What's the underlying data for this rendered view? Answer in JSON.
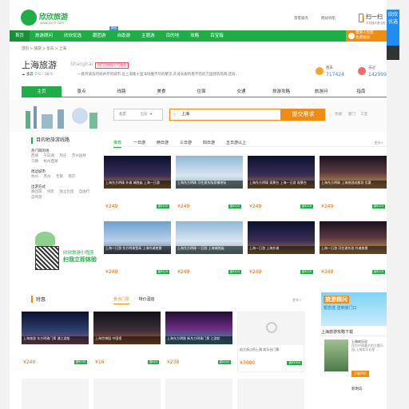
{
  "header": {
    "logo_text": "欣欣旅游",
    "logo_sub": "www.cncn.com",
    "links": [
      "游客服务",
      "网站导航",
      "扫一扫"
    ],
    "app_title": "扫一扫",
    "app_sub": "手机随手看全程"
  },
  "nav": {
    "items": [
      "首页",
      "旅游顾问",
      "欣欣优选",
      "跟团游",
      "自助游",
      "主题游",
      "目的地",
      "攻略",
      "百宝箱"
    ],
    "badge": "新品",
    "counsel_line1": "需要人帮您",
    "counsel_line2": "免费顾问"
  },
  "breadcrumb": "首页 > 旅游 > 华东 > 上海",
  "city": {
    "name": "上海旅游",
    "name_en": "Shanghai",
    "honor": "热门目的地人气旅游",
    "weather": "多云",
    "temp": "7℃ - 18℃",
    "intro": "一座开放与时尚并存的城市,位上海集十里洋场魔不尽的繁华,外滩长廊的看不完的万国建筑风情,还有..."
  },
  "stats": [
    {
      "label": "想去",
      "value": "717424"
    },
    {
      "label": "去过",
      "value": "142999"
    }
  ],
  "tabs": [
    "主页",
    "景点",
    "线路",
    "美食",
    "住宿",
    "交通",
    "旅游攻略",
    "旅游问",
    "指南"
  ],
  "search": {
    "city_label": "北京",
    "city_sub": "出发",
    "value": "上海",
    "button": "提交需求",
    "hot_label": "热搜:",
    "hot": [
      "厦门",
      "三亚"
    ]
  },
  "sidebar": {
    "title": "目的地旅游线路",
    "sections": [
      {
        "heading": "热门目的地",
        "links": [
          "西湖",
          "千岛湖",
          "周庄",
          "苏州园林",
          "乌镇",
          "杭州西湖"
        ]
      },
      {
        "heading": "周边城市",
        "links": [
          "杭州",
          "苏州",
          "无锡",
          "南京"
        ]
      },
      {
        "heading": "出游方式",
        "links": [
          "跟团游",
          "纯玩",
          "独立包团",
          "自由行",
          "自驾游"
        ]
      }
    ],
    "mini_line1": "欣欣旅游小程序",
    "mini_line2": "扫我立即体验"
  },
  "days_tabs": {
    "items": [
      "推荐",
      "一日游",
      "两日游",
      "三日游",
      "四日游",
      "五日游以上"
    ],
    "more": "更多>"
  },
  "route_cards": [
    {
      "title": "上海东方明珠+外滩+城隍庙一日游",
      "caption": "上海东方明珠 外滩 城隍庙 上海一日游",
      "price": "¥249",
      "save": "省¥120"
    },
    {
      "title": "上海东方明珠 登塔+浦江游船 一日游",
      "caption": "上海东方明珠 可往浦东陆家嘴地标",
      "price": "¥249",
      "save": "省¥120"
    },
    {
      "title": "上海东方明珠 登塔+浦江游船 一日游",
      "caption": "上海东方明珠 观景台 上海一日游 观景台",
      "price": "¥249",
      "save": "省¥120"
    },
    {
      "title": "上海东方明珠+上海一日游",
      "caption": "上海东方明珠 上海旅游成都游 优惠",
      "price": "¥249",
      "save": "省¥120"
    },
    {
      "title": "上海东方明珠+外滩+上海一日游",
      "caption": "上海一日游 东方明珠登高 上海外滩夜景",
      "price": "¥249",
      "save": "省¥120"
    },
    {
      "title": "上海东方明珠 上海一日游",
      "caption": "上海东方明珠 一日游 上海城隍庙",
      "price": "¥249",
      "save": "省¥120"
    },
    {
      "title": "上海东方明珠+城隍庙一日游",
      "caption": "上海一日游 上海外滩",
      "price": "¥249",
      "save": "省¥120"
    },
    {
      "title": "上海东方明珠 外滩 一日游",
      "caption": "上海一日游 可往浦东游 外滩夜景",
      "price": "¥249",
      "save": "省¥120"
    }
  ],
  "special": {
    "title": "特惠",
    "tabs": [
      "景点门票",
      "特价酒店"
    ],
    "more": "更多>",
    "cards": [
      {
        "title": "上海东方明珠+浦江游船",
        "caption": "上海旅游 东方明珠门票 浦江游船",
        "price": "¥240",
        "save": "省¥130"
      },
      {
        "title": "上海世博园 中国馆",
        "caption": "上海世博园 中国馆",
        "price": "¥16",
        "save": "省¥44"
      },
      {
        "title": "上海东方明珠 夜景游船",
        "caption": "上海东方明珠 新东方明珠门票 江游轮",
        "price": "¥238",
        "save": "省¥142"
      },
      {
        "title": "松江浙江桥上海 欢乐谷门票",
        "caption": "",
        "price": "¥3000",
        "save": "省¥2000"
      }
    ]
  },
  "ad": {
    "title": "旅游顾问",
    "sub": "帮您选 送到家门口"
  },
  "guide": {
    "title": "上海旅游攻略下载",
    "name": "上海欢乐谷",
    "desc": "作为中国最大的主题乐园,上海欢乐谷是...",
    "download": "下载PDF",
    "name2": "新明岛"
  },
  "rail": {
    "text": "欣欣优选"
  },
  "colors": {
    "brand_green": "#1fae45",
    "accent_orange": "#f08c12",
    "link_blue": "#3b8be8"
  }
}
